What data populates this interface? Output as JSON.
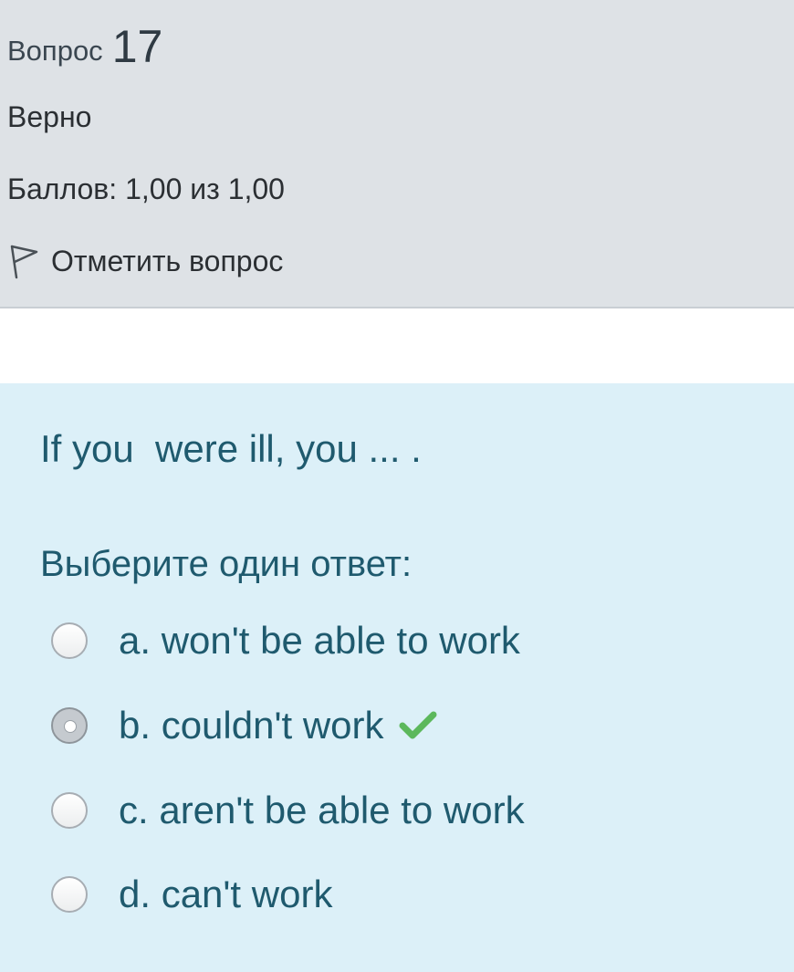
{
  "question_info": {
    "label": "Вопрос",
    "number": "17",
    "state": "Верно",
    "grade": "Баллов: 1,00 из 1,00",
    "flag_label": "Отметить вопрос"
  },
  "question": {
    "text": "If you  were ill, you ... .",
    "prompt": "Выберите один ответ:",
    "answers": [
      {
        "label": "a. won't be able to work",
        "selected": false,
        "correct": false
      },
      {
        "label": "b. couldn't work",
        "selected": true,
        "correct": true
      },
      {
        "label": "c. aren't be able to work",
        "selected": false,
        "correct": false
      },
      {
        "label": "d. can't work",
        "selected": false,
        "correct": false
      }
    ]
  },
  "icons": {
    "flag": "flag-outline-icon",
    "correct": "check-icon",
    "correct_color": "#5cb85c"
  },
  "colors": {
    "info_background": "#dee2e6",
    "content_background": "#dcf0f8",
    "content_text": "#1f5a6e"
  }
}
